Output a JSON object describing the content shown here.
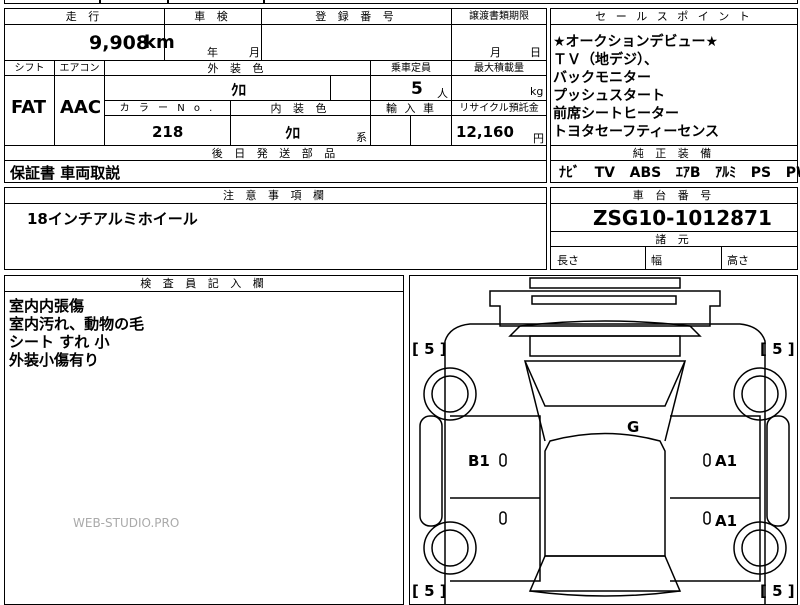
{
  "top_strip": {
    "partial_text": "日本仕様"
  },
  "main": {
    "headers": {
      "mileage": "走 行",
      "inspection": "車 検",
      "registration": "登 録 番 号",
      "transfer_deadline": "譲渡書類期限",
      "shift": "シフト",
      "aircon": "エアコン",
      "exterior_color": "外 装 色",
      "capacity": "乗車定員",
      "max_load": "最大積載量",
      "color_no": "カ ラ ー N o .",
      "interior_color": "内 装 色",
      "import": "輸 入 車",
      "recycle": "リサイクル預託金",
      "later_parts": "後 日 発 送 部 品"
    },
    "mileage_value": "9,908",
    "mileage_unit": "km",
    "inspection_year": "年",
    "inspection_month": "月",
    "transfer_month": "月",
    "transfer_day": "日",
    "shift_value": "FAT",
    "aircon_value": "AAC",
    "exterior_color_value": "ｸﾛ",
    "capacity_value": "5",
    "capacity_unit": "人",
    "max_load_unit": "kg",
    "color_no_value": "218",
    "interior_color_value": "ｸﾛ",
    "interior_color_suffix": "系",
    "recycle_value": "12,160",
    "recycle_unit": "円",
    "later_parts_value": "保証書 車両取説"
  },
  "sales_points": {
    "header": "セ ー ル ス ポ イ ン ト",
    "lines": [
      "★オークションデビュー★",
      "ＴＶ（地デジ）、",
      "バックモニター",
      "プッシュスタート",
      "前席シートヒーター",
      "トヨタセーフティーセンス"
    ]
  },
  "equipment": {
    "header": "純 正 装 備",
    "items": [
      "ﾅﾋﾞ",
      "TV",
      "ABS",
      "ｴｱB",
      "ｱﾙﾐ",
      "PS",
      "PW"
    ]
  },
  "notes": {
    "header": "注 意 事 項 欄",
    "value": "18インチアルミホイール"
  },
  "chassis": {
    "header": "車 台 番 号",
    "value": "ZSG10-1012871",
    "dims_header": "諸 元",
    "length": "長さ",
    "width": "幅",
    "height": "高さ"
  },
  "inspector": {
    "header": "検 査 員 記 入 欄",
    "lines": [
      "室内内張傷",
      "室内汚れ、動物の毛",
      "シート すれ 小",
      "外装小傷有り"
    ]
  },
  "diagram": {
    "tire_tl": "[ 5 ]",
    "tire_tr": "[ 5 ]",
    "tire_bl": "[ 5 ]",
    "tire_br": "[ 5 ]",
    "mark_g": "G",
    "mark_b1": "B1",
    "mark_a1_top": "A1",
    "mark_a1_bottom": "A1"
  },
  "watermark": "WEB-STUDIO.PRO"
}
